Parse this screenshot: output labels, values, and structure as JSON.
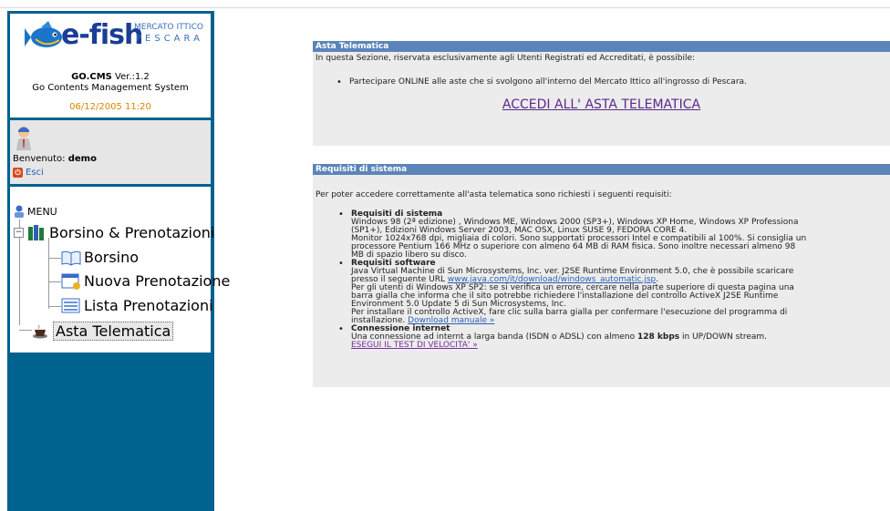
{
  "brand": {
    "logo_text": "e-fish",
    "mercato": "MERCATO ITTICO",
    "pescara": "PESCARA",
    "cms_name": "GO.CMS",
    "cms_version": "Ver.:1.2",
    "cms_desc": "Go Contents Management System",
    "datetime": "06/12/2005 11:20"
  },
  "user": {
    "welcome": "Benvenuto:",
    "username": "demo",
    "logout": "Esci"
  },
  "menu": {
    "root": "MENU",
    "group": "Borsino & Prenotazioni",
    "items": [
      "Borsino",
      "Nuova Prenotazione",
      "Lista Prenotazioni"
    ],
    "selected": "Asta Telematica"
  },
  "asta": {
    "header": "Asta Telematica",
    "intro": "In questa Sezione, riservata esclusivamente agli Utenti Registrati ed Accreditati, è possibile:",
    "bullet": "Partecipare ONLINE alle aste che si svolgono all'interno del Mercato Ittico all'ingrosso di Pescara.",
    "access_link": "ACCEDI ALL' ASTA TELEMATICA"
  },
  "requisiti": {
    "header": "Requisiti di sistema",
    "intro": "Per poter accedere correttamente all'asta telematica sono richiesti i seguenti requisiti:",
    "sys_title": "Requisiti di sistema",
    "sys_l1": "Windows 98 (2ª edizione) , Windows ME, Windows 2000 (SP3+), Windows XP Home, Windows XP Professiona",
    "sys_l2": "(SP1+), Edizioni Windows Server 2003, MAC OSX, Linux SUSE 9, FEDORA CORE 4.",
    "sys_l3": "Monitor 1024x768 dpi, migliaia di colori. Sono supportati processori Intel e compatibili al 100%. Si consiglia un",
    "sys_l4": "processore Pentium 166 MHz o superiore con almeno 64 MB di RAM fisica. Sono inoltre necessari almeno 98",
    "sys_l5": "MB di spazio libero su disco.",
    "sw_title": "Requisiti software",
    "sw_l1": "Java Virtual Machine di Sun Microsystems, Inc. ver. J2SE Runtime Environment 5.0, che è possibile scaricare",
    "sw_l2_pre": "presso il seguente URL",
    "sw_url": "www.java.com/it/download/windows_automatic.jsp",
    "sw_l2_post": ".",
    "sw_l3": "Per gli utenti di Windows XP SP2: se si verifica un errore, cercare nella parte superiore di questa pagina una",
    "sw_l4": "barra gialla che informa che il sito potrebbe richiedere l'installazione del controllo ActiveX J2SE Runtime",
    "sw_l5": "Environment 5.0 Update 5 di Sun Microsystems, Inc.",
    "sw_l6": "Per installare il controllo ActiveX, fare clic sulla barra gialla per confermare l'esecuzione del programma di",
    "sw_l7_pre": "installazione.",
    "sw_manual": "Download manuale »",
    "net_title": "Connessione internet",
    "net_pre": "Una connessione ad internt a larga banda (ISDN o ADSL) con almeno",
    "net_bold": "128 kbps",
    "net_post": "in UP/DOWN stream.",
    "speed_test": "ESEGUI IL TEST DI VELOCITA' »"
  },
  "colors": {
    "sidebar": "#00628f",
    "header": "#5b85b8",
    "panel_bg": "#ececec",
    "date": "#d98500"
  }
}
